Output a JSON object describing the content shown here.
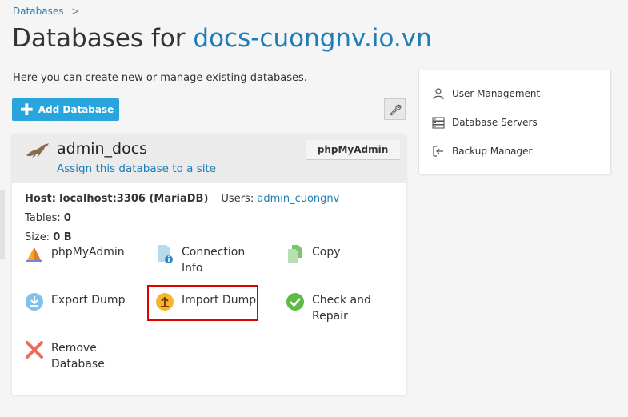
{
  "breadcrumb": {
    "databases": "Databases",
    "separator": ">"
  },
  "page": {
    "title_prefix": "Databases for ",
    "title_domain": "docs-cuongnv.io.vn",
    "intro": "Here you can create new or manage existing databases."
  },
  "toolbar": {
    "add_database": "Add Database",
    "tools_icon": "wrench-icon"
  },
  "database": {
    "name": "admin_docs",
    "assign_link": "Assign this database to a site",
    "phpmyadmin_button": "phpMyAdmin",
    "host_label": "Host:",
    "host_value": "localhost:3306 (MariaDB)",
    "users_label": "Users:",
    "users_value": "admin_cuongnv",
    "tables_label": "Tables:",
    "tables_value": "0",
    "size_label": "Size:",
    "size_value": "0 B",
    "actions": [
      {
        "label": "phpMyAdmin",
        "icon": "phpmyadmin-sail-icon"
      },
      {
        "label": "Connection Info",
        "icon": "connection-info-icon"
      },
      {
        "label": "Copy",
        "icon": "copy-icon"
      },
      {
        "label": "Export Dump",
        "icon": "export-dump-icon"
      },
      {
        "label": "Import Dump",
        "icon": "import-dump-icon"
      },
      {
        "label": "Check and Repair",
        "icon": "check-repair-icon"
      },
      {
        "label": "Remove Database",
        "icon": "remove-icon"
      }
    ]
  },
  "sidebar": {
    "items": [
      {
        "label": "User Management",
        "icon": "user-icon"
      },
      {
        "label": "Database Servers",
        "icon": "server-icon"
      },
      {
        "label": "Backup Manager",
        "icon": "backup-icon"
      }
    ]
  },
  "colors": {
    "link": "#1f7db7",
    "primary_button": "#28a5dd",
    "highlight_border": "#e00000"
  }
}
